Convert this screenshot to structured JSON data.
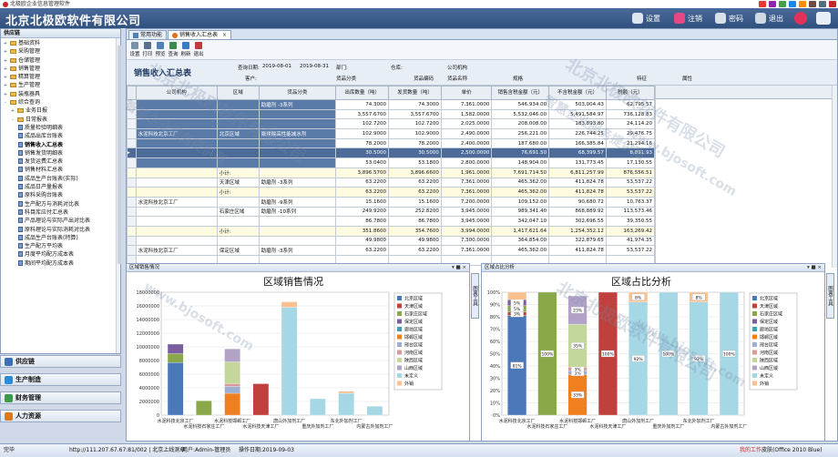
{
  "titlebar": {
    "text": "北极欧企业信息管理软件"
  },
  "header": {
    "brand": "北京北极欧软件有限公司",
    "buttons": [
      {
        "label": "设置",
        "icon": "gear-icon",
        "color": "#e0e6f0"
      },
      {
        "label": "注销",
        "icon": "lock-icon",
        "color": "#e54883"
      },
      {
        "label": "密码",
        "icon": "key-card-icon",
        "color": "#d8e0ea"
      },
      {
        "label": "退出",
        "icon": "exit-icon",
        "color": "#d0d8e4"
      }
    ]
  },
  "nav": {
    "header": "供应链",
    "items": [
      {
        "label": "基础资料",
        "level": 0,
        "type": "folder",
        "toggle": "+"
      },
      {
        "label": "采购管理",
        "level": 0,
        "type": "folder",
        "toggle": "+"
      },
      {
        "label": "仓储管理",
        "level": 0,
        "type": "folder",
        "toggle": "+"
      },
      {
        "label": "销售管理",
        "level": 0,
        "type": "folder",
        "toggle": "+"
      },
      {
        "label": "精算管理",
        "level": 0,
        "type": "folder",
        "toggle": "+"
      },
      {
        "label": "生产管理",
        "level": 0,
        "type": "folder",
        "toggle": "+"
      },
      {
        "label": "装瓶器具",
        "level": 0,
        "type": "folder",
        "toggle": "+"
      },
      {
        "label": "综合查询",
        "level": 0,
        "type": "folder",
        "toggle": "-"
      },
      {
        "label": "业务日报",
        "level": 1,
        "type": "folder",
        "toggle": "+"
      },
      {
        "label": "日常报表",
        "level": 1,
        "type": "folder",
        "toggle": "-"
      },
      {
        "label": "质量检验明细表",
        "level": 2,
        "type": "page"
      },
      {
        "label": "成品出库台账表",
        "level": 2,
        "type": "page"
      },
      {
        "label": "销售收入汇总表",
        "level": 2,
        "type": "page",
        "active": true
      },
      {
        "label": "销售发货明细表",
        "level": 2,
        "type": "page"
      },
      {
        "label": "发货运费汇总表",
        "level": 2,
        "type": "page"
      },
      {
        "label": "销售材料汇总表",
        "level": 2,
        "type": "page"
      },
      {
        "label": "成品生产台账表(实际)",
        "level": 2,
        "type": "page"
      },
      {
        "label": "成品日产量报表",
        "level": 2,
        "type": "page"
      },
      {
        "label": "原料采购台账表",
        "level": 2,
        "type": "page"
      },
      {
        "label": "生产配方与消耗对比表",
        "level": 2,
        "type": "page"
      },
      {
        "label": "科目库应付汇总表",
        "level": 2,
        "type": "page"
      },
      {
        "label": "产品理论与实际产出对比表",
        "level": 2,
        "type": "page"
      },
      {
        "label": "原料理论与实际消耗对比表",
        "level": 2,
        "type": "page"
      },
      {
        "label": "成品生产台账表(特算)",
        "level": 2,
        "type": "page"
      },
      {
        "label": "生产配方平均表",
        "level": 2,
        "type": "page"
      },
      {
        "label": "月度平均配方成本表",
        "level": 2,
        "type": "page"
      },
      {
        "label": "期间平均配方成本表",
        "level": 2,
        "type": "page"
      }
    ]
  },
  "modules": [
    {
      "label": "供应链",
      "color": "#3b6fb6"
    },
    {
      "label": "生产制造",
      "color": "#2d8bd6"
    },
    {
      "label": "财务管理",
      "color": "#3c9a4a"
    },
    {
      "label": "人力资源",
      "color": "#d77b1e"
    }
  ],
  "tabs": [
    {
      "label": "常用功能",
      "selected": false
    },
    {
      "label": "销售收入汇总表",
      "selected": true,
      "close": "×"
    }
  ],
  "toolbar": [
    {
      "label": "设置",
      "color": "#7b8fa8"
    },
    {
      "label": "打印",
      "color": "#5a6f8c"
    },
    {
      "label": "预览",
      "color": "#4e7fb7"
    },
    {
      "label": "查询",
      "color": "#3b8a4c"
    },
    {
      "label": "刷新",
      "color": "#3a79c4"
    },
    {
      "label": "退出",
      "color": "#c43a3a"
    }
  ],
  "report": {
    "title": "销售收入汇总表",
    "filters": {
      "date_label": "查询日期:",
      "date_from": "2019-08-01",
      "date_to": "2019-08-31",
      "dept_label": "部门:",
      "warehouse_label": "仓库:",
      "org_label": "公司机构",
      "customer_label": "客户:",
      "product_cat_label": "货品分类",
      "product_code_label": "货品编码",
      "product_label": "货品名称",
      "spec_label": "规格",
      "feature_label": "特征",
      "attr_label": "属性"
    }
  },
  "grid": {
    "columns": [
      "公司机构",
      "区域",
      "货品分类",
      "出库数量（吨）",
      "发货数量（吨）",
      "单价",
      "销售含税金额（元）",
      "不含税金额（元）",
      "税额（元）"
    ],
    "rows": [
      {
        "org": "",
        "region": "",
        "category": "助磨剂 -3系列",
        "out_qty": "74.3000",
        "ship_qty": "74.3000",
        "price": "7,361.0000",
        "tax_amt": "546,934.00",
        "net_amt": "503,004.43",
        "tax": "62,795.57",
        "kind": "merge"
      },
      {
        "org": "",
        "region": "",
        "category": "",
        "out_qty": "3,557.6700",
        "ship_qty": "3,557.6700",
        "price": "1,582.0000",
        "tax_amt": "5,532,046.00",
        "net_amt": "5,491,584.97",
        "tax": "736,128.83",
        "kind": "merge"
      },
      {
        "org": "",
        "region": "",
        "category": "",
        "out_qty": "102.7200",
        "ship_qty": "102.7200",
        "price": "2,025.0000",
        "tax_amt": "208,008.00",
        "net_amt": "183,893.80",
        "tax": "24,114.20",
        "kind": "merge"
      },
      {
        "org": "水泥科技北京工厂",
        "region": "北京区域",
        "category": "聚羧酸高性能减水剂",
        "out_qty": "102.9000",
        "ship_qty": "102.9000",
        "price": "2,490.0000",
        "tax_amt": "256,221.00",
        "net_amt": "226,744.25",
        "tax": "29,476.75",
        "kind": "merge"
      },
      {
        "org": "",
        "region": "",
        "category": "",
        "out_qty": "78.2000",
        "ship_qty": "78.2000",
        "price": "2,400.0000",
        "tax_amt": "187,680.00",
        "net_amt": "166,385.84",
        "tax": "21,294.16",
        "kind": "merge"
      },
      {
        "org": "",
        "region": "",
        "category": "",
        "out_qty": "30.5000",
        "ship_qty": "30.5000",
        "price": "2,500.0000",
        "tax_amt": "76,691.50",
        "net_amt": "68,399.57",
        "tax": "8,891.93",
        "kind": "sel"
      },
      {
        "org": "",
        "region": "",
        "category": "",
        "out_qty": "53.0400",
        "ship_qty": "53.1800",
        "price": "2,800.0000",
        "tax_amt": "148,904.00",
        "net_amt": "131,773.45",
        "tax": "17,130.55",
        "kind": "merge"
      },
      {
        "org": "",
        "region": "小计:",
        "category": "",
        "out_qty": "3,896.5700",
        "ship_qty": "3,896.6600",
        "price": "1,961.0000",
        "tax_amt": "7,691,714.50",
        "net_amt": "6,811,257.99",
        "tax": "876,556.51",
        "kind": "subtotal"
      },
      {
        "org": "",
        "region": "天津区域",
        "category": "助磨剂 -3系列",
        "out_qty": "63.2200",
        "ship_qty": "63.2200",
        "price": "7,361.0000",
        "tax_amt": "465,362.00",
        "net_amt": "411,824.78",
        "tax": "53,537.22",
        "kind": ""
      },
      {
        "org": "",
        "region": "小计:",
        "category": "",
        "out_qty": "63.2200",
        "ship_qty": "63.2200",
        "price": "7,361.0000",
        "tax_amt": "465,362.00",
        "net_amt": "411,824.78",
        "tax": "53,537.22",
        "kind": "subtotal"
      },
      {
        "org": "水泥科技北京工厂",
        "region": "",
        "category": "助磨剂 -9系列",
        "out_qty": "15.1600",
        "ship_qty": "15.1600",
        "price": "7,200.0000",
        "tax_amt": "109,152.00",
        "net_amt": "90,680.72",
        "tax": "10,763.37",
        "kind": ""
      },
      {
        "org": "",
        "region": "石家庄区域",
        "category": "助磨剂 -10系列",
        "out_qty": "249.9200",
        "ship_qty": "252.8200",
        "price": "3,945.0000",
        "tax_amt": "989,341.40",
        "net_amt": "868,889.92",
        "tax": "113,573.46",
        "kind": ""
      },
      {
        "org": "",
        "region": "",
        "category": "",
        "out_qty": "86.7800",
        "ship_qty": "86.7800",
        "price": "3,945.0000",
        "tax_amt": "342,047.10",
        "net_amt": "302,696.55",
        "tax": "39,350.55",
        "kind": ""
      },
      {
        "org": "",
        "region": "小计:",
        "category": "",
        "out_qty": "351.8600",
        "ship_qty": "354.7600",
        "price": "3,994.0000",
        "tax_amt": "1,417,621.64",
        "net_amt": "1,254,352.12",
        "tax": "163,269.42",
        "kind": "subtotal"
      },
      {
        "org": "",
        "region": "",
        "category": "",
        "out_qty": "49.9800",
        "ship_qty": "49.9800",
        "price": "7,300.0000",
        "tax_amt": "364,854.00",
        "net_amt": "322,879.65",
        "tax": "41,974.35",
        "kind": ""
      },
      {
        "org": "水泥科技北京工厂",
        "region": "保定区域",
        "category": "助磨剂 -3系列",
        "out_qty": "63.2200",
        "ship_qty": "63.2200",
        "price": "7,361.0000",
        "tax_amt": "465,362.00",
        "net_amt": "411,824.78",
        "tax": "53,537.22",
        "kind": ""
      },
      {
        "org": "",
        "region": "",
        "category": "",
        "out_qty": "",
        "ship_qty": "",
        "price": "",
        "tax_amt": "",
        "net_amt": "",
        "tax": "",
        "kind": ""
      }
    ]
  },
  "panels": {
    "left_title": "区域销售情况",
    "right_title": "区域占比分析",
    "side_tab": "图表工具",
    "controls": "▾ ■ ×"
  },
  "chart_data": [
    {
      "type": "bar",
      "title": "区域销售情况",
      "ylim": [
        0,
        18000000
      ],
      "yticks": [
        0,
        2000000,
        4000000,
        6000000,
        8000000,
        10000000,
        12000000,
        14000000,
        16000000,
        18000000
      ],
      "categories": [
        "水泥科技北京工厂",
        "水泥科技石家庄工厂",
        "水泥科技邯郸工厂",
        "水泥科技天津工厂",
        "唐山外加剂工厂",
        "重庆外加剂工厂",
        "东北外加剂工厂",
        "内蒙古外加剂工厂"
      ],
      "stacked": true,
      "legend": "right",
      "series": [
        {
          "name": "北京区域",
          "color": "#4a78b8",
          "values": [
            7700000,
            0,
            0,
            0,
            0,
            0,
            0,
            0
          ]
        },
        {
          "name": "天津区域",
          "color": "#c0403d",
          "values": [
            0,
            0,
            0,
            4600000,
            0,
            0,
            0,
            0
          ]
        },
        {
          "name": "石家庄区域",
          "color": "#8aa84a",
          "values": [
            1300000,
            2100000,
            0,
            0,
            0,
            0,
            0,
            0
          ]
        },
        {
          "name": "保定区域",
          "color": "#7a5fa0",
          "values": [
            1400000,
            0,
            0,
            0,
            0,
            0,
            0,
            0
          ]
        },
        {
          "name": "廊坊区域",
          "color": "#3f9fb5",
          "values": [
            0,
            0,
            0,
            0,
            0,
            0,
            0,
            0
          ]
        },
        {
          "name": "邯郸区域",
          "color": "#f07f1f",
          "values": [
            0,
            0,
            3200000,
            0,
            0,
            0,
            0,
            0
          ]
        },
        {
          "name": "邢台区域",
          "color": "#9bb0d3",
          "values": [
            0,
            0,
            1000000,
            0,
            0,
            0,
            0,
            0
          ]
        },
        {
          "name": "河南区域",
          "color": "#d99b98",
          "values": [
            0,
            0,
            400000,
            0,
            0,
            0,
            0,
            0
          ]
        },
        {
          "name": "陕西区域",
          "color": "#c3d69b",
          "values": [
            0,
            0,
            3200000,
            0,
            0,
            0,
            0,
            0
          ]
        },
        {
          "name": "山西区域",
          "color": "#b3a2c7",
          "values": [
            0,
            0,
            1900000,
            0,
            0,
            0,
            0,
            0
          ]
        },
        {
          "name": "未定义",
          "color": "#a6d7e4",
          "values": [
            0,
            0,
            0,
            0,
            15800000,
            2400000,
            3200000,
            1300000
          ]
        },
        {
          "name": "外销",
          "color": "#fac090",
          "values": [
            0,
            0,
            0,
            0,
            800000,
            0,
            300000,
            0
          ]
        }
      ]
    },
    {
      "type": "bar",
      "title": "区域占比分析",
      "ylim": [
        0,
        1
      ],
      "yticks": [
        0,
        0.1,
        0.2,
        0.3,
        0.4,
        0.5,
        0.6,
        0.7,
        0.8,
        0.9,
        1
      ],
      "categories": [
        "水泥科技北京工厂",
        "水泥科技石家庄工厂",
        "水泥科技邯郸工厂",
        "水泥科技天津工厂",
        "唐山外加剂工厂",
        "重庆外加剂工厂",
        "东北外加剂工厂",
        "内蒙古外加剂工厂"
      ],
      "stacked": true,
      "percent": true,
      "legend": "right",
      "series": [
        {
          "name": "北京区域",
          "color": "#4a78b8",
          "values": [
            0.81,
            0,
            0,
            0,
            0,
            0,
            0,
            0
          ],
          "labels": [
            "81%",
            "",
            "",
            "",
            "",
            "",
            "",
            ""
          ]
        },
        {
          "name": "天津区域",
          "color": "#c0403d",
          "values": [
            0.03,
            0,
            0,
            1,
            0,
            0,
            0,
            0
          ],
          "labels": [
            "3%",
            "",
            "",
            "100%",
            "",
            "",
            "",
            ""
          ]
        },
        {
          "name": "石家庄区域",
          "color": "#8aa84a",
          "values": [
            0.05,
            1,
            0,
            0,
            0,
            0,
            0,
            0
          ],
          "labels": [
            "5%",
            "100%",
            "",
            "",
            "",
            "",
            "",
            ""
          ]
        },
        {
          "name": "保定区域",
          "color": "#7a5fa0",
          "values": [
            0.05,
            0,
            0,
            0,
            0,
            0,
            0,
            0
          ],
          "labels": [
            "5%",
            "",
            "",
            "",
            "",
            "",
            "",
            ""
          ]
        },
        {
          "name": "廊坊区域",
          "color": "#3f9fb5",
          "values": [
            0,
            0,
            0,
            0,
            0,
            0,
            0,
            0
          ],
          "labels": [
            "",
            "",
            "",
            "",
            "",
            "",
            "",
            ""
          ]
        },
        {
          "name": "邯郸区域",
          "color": "#f07f1f",
          "values": [
            0,
            0,
            0.33,
            0,
            0,
            0,
            0,
            0
          ],
          "labels": [
            "",
            "",
            "33%",
            "",
            "",
            "",
            "",
            ""
          ]
        },
        {
          "name": "邢台区域",
          "color": "#9bb0d3",
          "values": [
            0,
            0,
            0.03,
            0,
            0,
            0,
            0,
            0
          ],
          "labels": [
            "",
            "",
            "3%",
            "",
            "",
            "",
            "",
            ""
          ]
        },
        {
          "name": "河南区域",
          "color": "#d99b98",
          "values": [
            0,
            0,
            0.03,
            0,
            0,
            0,
            0,
            0
          ],
          "labels": [
            "",
            "",
            "3%",
            "",
            "",
            "",
            "",
            ""
          ]
        },
        {
          "name": "陕西区域",
          "color": "#c3d69b",
          "values": [
            0,
            0,
            0.35,
            0,
            0,
            0,
            0,
            0
          ],
          "labels": [
            "",
            "",
            "35%",
            "",
            "",
            "",
            "",
            ""
          ]
        },
        {
          "name": "山西区域",
          "color": "#b3a2c7",
          "values": [
            0,
            0,
            0.23,
            0,
            0,
            0,
            0,
            0
          ],
          "labels": [
            "",
            "",
            "23%",
            "",
            "",
            "",
            "",
            ""
          ]
        },
        {
          "name": "未定义",
          "color": "#a6d7e4",
          "values": [
            0,
            0,
            0,
            0,
            0.92,
            1,
            0.92,
            1
          ],
          "labels": [
            "",
            "",
            "",
            "",
            "92%",
            "100%",
            "92%",
            "100%"
          ]
        },
        {
          "name": "外销",
          "color": "#fac090",
          "values": [
            0.06,
            0,
            0,
            0,
            0.08,
            0,
            0.08,
            0
          ],
          "labels": [
            "",
            "",
            "",
            "",
            "8%",
            "",
            "8%",
            ""
          ]
        }
      ]
    }
  ],
  "status": {
    "ready": "完毕",
    "server": "http://111.207.67.67:81/002 | 北京上线测章",
    "user": "用户:Admin-管理员",
    "date": "操作日期:2019-09-03",
    "workflow": "我的工作",
    "skin": "皮肤(Office 2010 Blue)"
  },
  "watermark": {
    "line1": "北京北极欧软件有限公司",
    "line2": "智慧企业服务提供商",
    "url": "www.bjosoft.com"
  }
}
